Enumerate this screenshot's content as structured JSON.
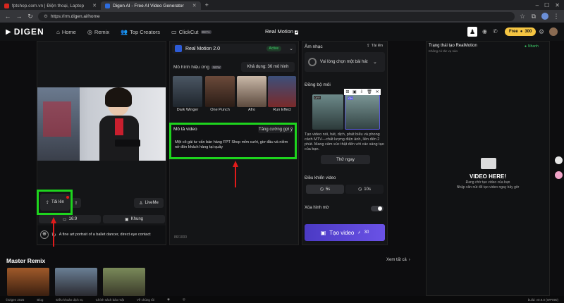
{
  "browser": {
    "tabs": [
      {
        "title": "fptshop.com.vn | Điện thoại, Laptop",
        "active": false
      },
      {
        "title": "Digen AI - Free AI Video Generator",
        "active": true
      }
    ],
    "new_tab": "+",
    "url": "https://rm.digen.ai/home"
  },
  "app": {
    "logo": "DIGEN",
    "nav": [
      {
        "label": "Home",
        "icon": "home-icon"
      },
      {
        "label": "Remix",
        "icon": "remix-icon"
      },
      {
        "label": "Top Creators",
        "icon": "people-icon"
      },
      {
        "label": "ClickCut",
        "icon": "clickcut-icon",
        "badge": "BETA"
      }
    ],
    "center_title": "Real Motion",
    "center_badge": "2",
    "free_label": "Free",
    "credits": "300"
  },
  "left": {
    "upload_label": "Tải lên",
    "liveme_label": "LiveMe",
    "ratio_label": "16:9",
    "frame_label": "Khung",
    "prompt_text": "A fine art portrait of a ballet dancer, direct eye contact"
  },
  "middle": {
    "model_name": "Real Motion 2.0",
    "active_label": "Active",
    "effects_title": "Mô hình hiệu ứng",
    "effects_badge": "NEW",
    "available_label": "Khả dụng: 36 mô hình",
    "effects": [
      "Dark Winger",
      "One Punch",
      "Afro",
      "Run Effect"
    ],
    "desc_title": "Mô tả video",
    "enhance_label": "Tăng cường gợi ý",
    "desc_text": "Một cô gái tư vấn bán hàng FPT Shop mỉm cười, giơ đầu và niềm nở đón khách hàng tại quầy",
    "char_count": "86/1000"
  },
  "right": {
    "music_title": "Âm nhạc",
    "music_upload": "Tải lên",
    "music_select": "Vui lòng chọn một bài hát",
    "lipsync_title": "Đồng bộ môi",
    "off_label": "OFF",
    "on_label": "ON",
    "lipsync_desc": "Tạo video nói, hát, dịch, phát biểu và phong cách MTV—chất lượng điện ảnh, liền đến 2 phút. Mang cảm xúc thật đến với các sáng tạo của bạn.",
    "try_label": "Thử ngay",
    "control_title": "Điều khiển video",
    "dur_5": "5s",
    "dur_10": "10s",
    "blur_label": "Xóa hình mờ",
    "create_label": "Tạo video",
    "create_cost": "30"
  },
  "status_panel": {
    "title": "Trạng thái tạo RealMotion",
    "subtitle": "Không có tác vụ nào",
    "fast_label": "Nhanh",
    "video_here": "VIDEO HERE!",
    "wait_1": "Đang chờ tạo video của bạn",
    "wait_2": "Nhập văn nút để tạo video ngay bây giờ"
  },
  "remix": {
    "title": "Master Remix",
    "see_all": "Xem tất cả"
  },
  "footer": {
    "items": [
      "©Digen 2025",
      "Blog",
      "Điều khoản dịch vụ",
      "Chính sách bảo mật",
      "Về chúng tôi"
    ],
    "build": "build: v0.9.0 (WP090)"
  },
  "colors": {
    "accent_green": "#1ed41e",
    "annotation_red": "#e01b1b",
    "create_button": "#5b46d6",
    "gold": "#f5c542"
  }
}
